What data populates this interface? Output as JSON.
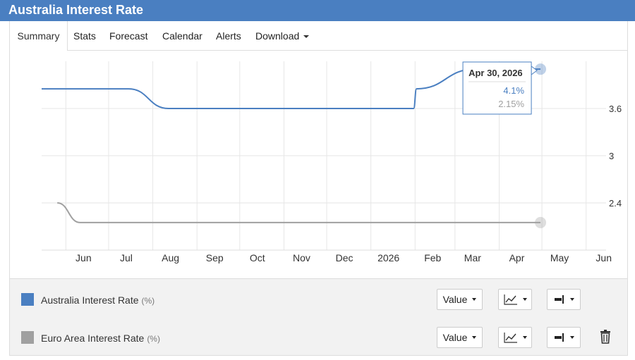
{
  "header": {
    "title": "Australia Interest Rate"
  },
  "tabs": [
    {
      "label": "Summary"
    },
    {
      "label": "Stats"
    },
    {
      "label": "Forecast"
    },
    {
      "label": "Calendar"
    },
    {
      "label": "Alerts"
    },
    {
      "label": "Download"
    }
  ],
  "chart_data": {
    "type": "line",
    "x_axis": {
      "ticks": [
        "Jun",
        "Jul",
        "Aug",
        "Sep",
        "Oct",
        "Nov",
        "Dec",
        "2026",
        "Feb",
        "Mar",
        "Apr",
        "May",
        "Jun"
      ],
      "range": [
        "2025-05-15",
        "2026-06-15"
      ]
    },
    "y_axis": {
      "ticks": [
        2.4,
        3,
        3.6
      ],
      "range": [
        1.8,
        4.2
      ],
      "position": "right"
    },
    "grid": true,
    "series": [
      {
        "name": "Australia Interest Rate",
        "unit": "(%)",
        "color": "#4a7fc1",
        "points": [
          {
            "x": "2025-05-15",
            "y": 3.85
          },
          {
            "x": "2025-07-15",
            "y": 3.85
          },
          {
            "x": "2025-08-12",
            "y": 3.6
          },
          {
            "x": "2026-01-31",
            "y": 3.6
          },
          {
            "x": "2026-02-02",
            "y": 3.85
          },
          {
            "x": "2026-03-15",
            "y": 4.1
          },
          {
            "x": "2026-04-30",
            "y": 4.1
          }
        ]
      },
      {
        "name": "Euro Area Interest Rate",
        "unit": "(%)",
        "color": "#a0a0a0",
        "points": [
          {
            "x": "2025-05-26",
            "y": 2.4
          },
          {
            "x": "2025-06-11",
            "y": 2.15
          },
          {
            "x": "2026-04-30",
            "y": 2.15
          }
        ]
      }
    ],
    "tooltip": {
      "date": "Apr 30, 2026",
      "values": [
        "4.1%",
        "2.15%"
      ]
    }
  },
  "legend_controls": {
    "value_label": "Value",
    "line_chart_icon": "line-chart-icon",
    "axis_icon": "axis-right-icon",
    "delete_icon": "trash-icon"
  }
}
